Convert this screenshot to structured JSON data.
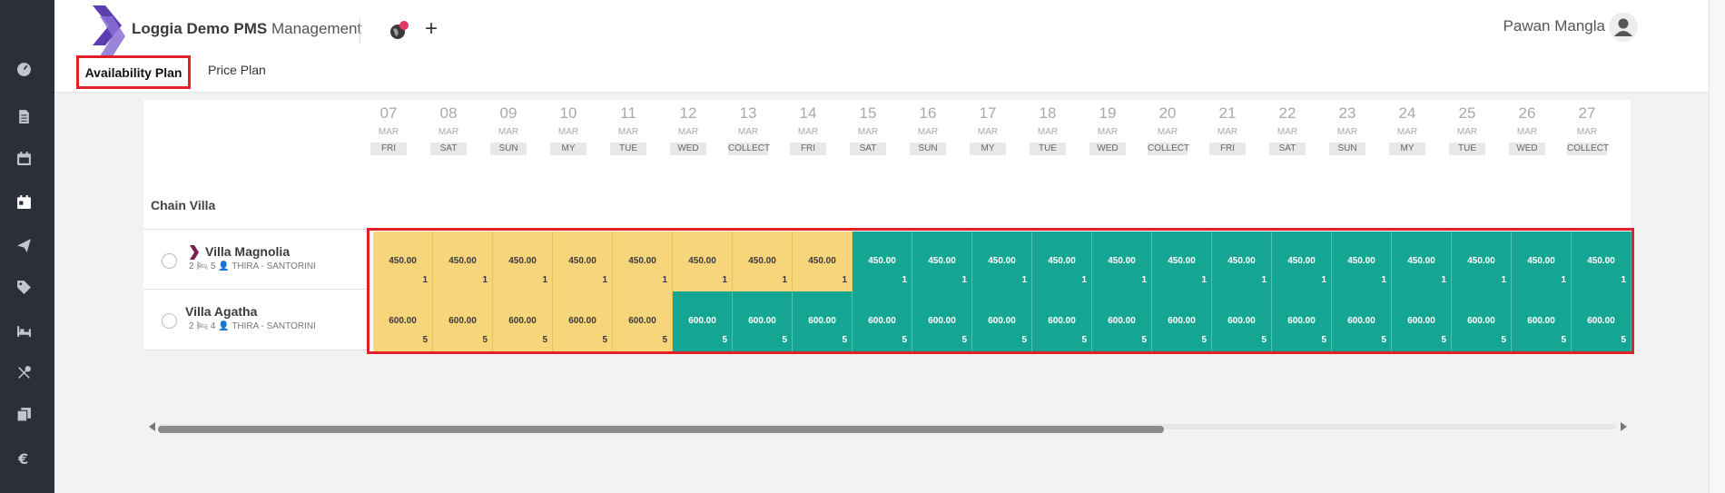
{
  "app": {
    "title_bold": "Loggia Demo PMS",
    "title_normal": "Management"
  },
  "user": {
    "name": "Pawan Mangla"
  },
  "tabs": [
    {
      "label": "Availability Plan",
      "active": true
    },
    {
      "label": "Price Plan",
      "active": false
    }
  ],
  "sidebar": {
    "items": [
      {
        "icon": "dashboard-gauge-icon"
      },
      {
        "icon": "document-icon"
      },
      {
        "icon": "calendar-icon"
      },
      {
        "icon": "calendar-active-icon",
        "active": true
      },
      {
        "icon": "paper-plane-icon"
      },
      {
        "icon": "tag-icon"
      },
      {
        "icon": "bed-icon"
      },
      {
        "icon": "tools-icon"
      },
      {
        "icon": "copy-icon"
      },
      {
        "icon": "euro-icon"
      }
    ]
  },
  "dates": [
    {
      "day": "07",
      "month": "MAR",
      "dow": "FRI"
    },
    {
      "day": "08",
      "month": "MAR",
      "dow": "SAT"
    },
    {
      "day": "09",
      "month": "MAR",
      "dow": "SUN"
    },
    {
      "day": "10",
      "month": "MAR",
      "dow": "MY"
    },
    {
      "day": "11",
      "month": "MAR",
      "dow": "TUE"
    },
    {
      "day": "12",
      "month": "MAR",
      "dow": "WED"
    },
    {
      "day": "13",
      "month": "MAR",
      "dow": "COLLECT"
    },
    {
      "day": "14",
      "month": "MAR",
      "dow": "FRI"
    },
    {
      "day": "15",
      "month": "MAR",
      "dow": "SAT"
    },
    {
      "day": "16",
      "month": "MAR",
      "dow": "SUN"
    },
    {
      "day": "17",
      "month": "MAR",
      "dow": "MY"
    },
    {
      "day": "18",
      "month": "MAR",
      "dow": "TUE"
    },
    {
      "day": "19",
      "month": "MAR",
      "dow": "WED"
    },
    {
      "day": "20",
      "month": "MAR",
      "dow": "COLLECT"
    },
    {
      "day": "21",
      "month": "MAR",
      "dow": "FRI"
    },
    {
      "day": "22",
      "month": "MAR",
      "dow": "SAT"
    },
    {
      "day": "23",
      "month": "MAR",
      "dow": "SUN"
    },
    {
      "day": "24",
      "month": "MAR",
      "dow": "MY"
    },
    {
      "day": "25",
      "month": "MAR",
      "dow": "TUE"
    },
    {
      "day": "26",
      "month": "MAR",
      "dow": "WED"
    },
    {
      "day": "27",
      "month": "MAR",
      "dow": "COLLECT"
    }
  ],
  "group": {
    "label": "Chain Villa"
  },
  "rooms": [
    {
      "name": "Villa Magnolia",
      "bedrooms": "2",
      "guests": "5",
      "location": "THIRA - SANTORINI",
      "has_brand_icon": true,
      "cells": [
        {
          "price": "450.00",
          "avail": "1",
          "status": "yellow"
        },
        {
          "price": "450.00",
          "avail": "1",
          "status": "yellow"
        },
        {
          "price": "450.00",
          "avail": "1",
          "status": "yellow"
        },
        {
          "price": "450.00",
          "avail": "1",
          "status": "yellow"
        },
        {
          "price": "450.00",
          "avail": "1",
          "status": "yellow"
        },
        {
          "price": "450.00",
          "avail": "1",
          "status": "yellow"
        },
        {
          "price": "450.00",
          "avail": "1",
          "status": "yellow"
        },
        {
          "price": "450.00",
          "avail": "1",
          "status": "yellow"
        },
        {
          "price": "450.00",
          "avail": "1",
          "status": "green"
        },
        {
          "price": "450.00",
          "avail": "1",
          "status": "green"
        },
        {
          "price": "450.00",
          "avail": "1",
          "status": "green"
        },
        {
          "price": "450.00",
          "avail": "1",
          "status": "green"
        },
        {
          "price": "450.00",
          "avail": "1",
          "status": "green"
        },
        {
          "price": "450.00",
          "avail": "1",
          "status": "green"
        },
        {
          "price": "450.00",
          "avail": "1",
          "status": "green"
        },
        {
          "price": "450.00",
          "avail": "1",
          "status": "green"
        },
        {
          "price": "450.00",
          "avail": "1",
          "status": "green"
        },
        {
          "price": "450.00",
          "avail": "1",
          "status": "green"
        },
        {
          "price": "450.00",
          "avail": "1",
          "status": "green"
        },
        {
          "price": "450.00",
          "avail": "1",
          "status": "green"
        },
        {
          "price": "450.00",
          "avail": "1",
          "status": "green"
        }
      ]
    },
    {
      "name": "Villa Agatha",
      "bedrooms": "2",
      "guests": "4",
      "location": "THIRA - SANTORINI",
      "has_brand_icon": false,
      "cells": [
        {
          "price": "600.00",
          "avail": "5",
          "status": "yellow"
        },
        {
          "price": "600.00",
          "avail": "5",
          "status": "yellow"
        },
        {
          "price": "600.00",
          "avail": "5",
          "status": "yellow"
        },
        {
          "price": "600.00",
          "avail": "5",
          "status": "yellow"
        },
        {
          "price": "600.00",
          "avail": "5",
          "status": "yellow"
        },
        {
          "price": "600.00",
          "avail": "5",
          "status": "green"
        },
        {
          "price": "600.00",
          "avail": "5",
          "status": "green"
        },
        {
          "price": "600.00",
          "avail": "5",
          "status": "green"
        },
        {
          "price": "600.00",
          "avail": "5",
          "status": "green"
        },
        {
          "price": "600.00",
          "avail": "5",
          "status": "green"
        },
        {
          "price": "600.00",
          "avail": "5",
          "status": "green"
        },
        {
          "price": "600.00",
          "avail": "5",
          "status": "green"
        },
        {
          "price": "600.00",
          "avail": "5",
          "status": "green"
        },
        {
          "price": "600.00",
          "avail": "5",
          "status": "green"
        },
        {
          "price": "600.00",
          "avail": "5",
          "status": "green"
        },
        {
          "price": "600.00",
          "avail": "5",
          "status": "green"
        },
        {
          "price": "600.00",
          "avail": "5",
          "status": "green"
        },
        {
          "price": "600.00",
          "avail": "5",
          "status": "green"
        },
        {
          "price": "600.00",
          "avail": "5",
          "status": "green"
        },
        {
          "price": "600.00",
          "avail": "5",
          "status": "green"
        },
        {
          "price": "600.00",
          "avail": "5",
          "status": "green"
        }
      ]
    }
  ],
  "scroll": {
    "position_fraction": 0.0,
    "visible_fraction": 0.69
  },
  "colors": {
    "accent_red": "#e2202a",
    "cell_yellow": "#f7d57a",
    "cell_green": "#15a693",
    "sidebar_bg": "#2b2f38",
    "logo_purple": "#5b3fb0"
  }
}
